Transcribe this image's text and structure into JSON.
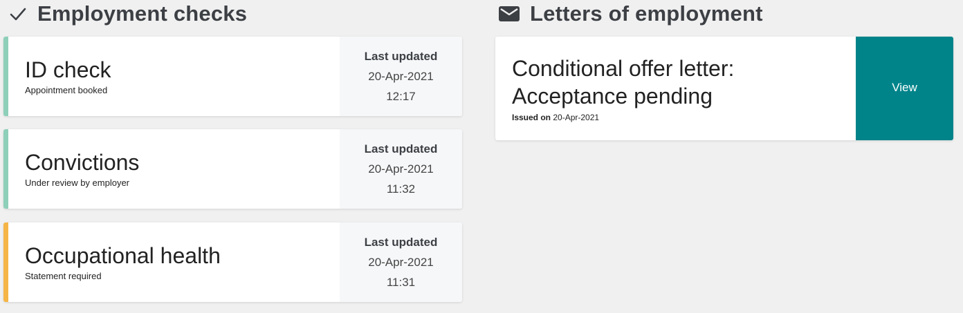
{
  "colors": {
    "complete_stripe": "#8ecfb9",
    "pending_stripe": "#f5b547",
    "view_button": "#00848a",
    "heading": "#3c3f44"
  },
  "employment_checks": {
    "heading": "Employment checks",
    "icon": "checkmark-icon",
    "items": [
      {
        "title": "ID check",
        "status": "Appointment booked",
        "updated_label": "Last updated",
        "date": "20-Apr-2021",
        "time": "12:17",
        "stripe": "green"
      },
      {
        "title": "Convictions",
        "status": "Under review by employer",
        "updated_label": "Last updated",
        "date": "20-Apr-2021",
        "time": "11:32",
        "stripe": "green"
      },
      {
        "title": "Occupational health",
        "status": "Statement required",
        "updated_label": "Last updated",
        "date": "20-Apr-2021",
        "time": "11:31",
        "stripe": "amber"
      }
    ]
  },
  "letters": {
    "heading": "Letters of employment",
    "icon": "envelope-icon",
    "items": [
      {
        "title_line1": "Conditional offer letter:",
        "title_line2": "Acceptance pending",
        "issued_label": "Issued on",
        "issued_date": "20-Apr-2021",
        "button_label": "View"
      }
    ]
  }
}
